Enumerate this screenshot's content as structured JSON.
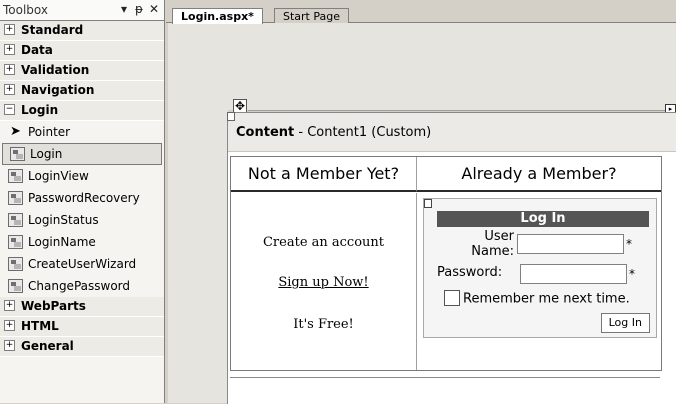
{
  "toolbox": {
    "title": "Toolbox",
    "header_buttons": {
      "dropdown": "▾",
      "pin": "ᵽ",
      "close": "✕"
    },
    "categories_top": [
      {
        "label": "Standard",
        "expander": "+"
      },
      {
        "label": "Data",
        "expander": "+"
      },
      {
        "label": "Validation",
        "expander": "+"
      },
      {
        "label": "Navigation",
        "expander": "+"
      }
    ],
    "login_category": {
      "label": "Login",
      "expander": "−"
    },
    "tools": [
      {
        "label": "Pointer",
        "icon": "pointer-icon"
      },
      {
        "label": "Login",
        "icon": "login-icon",
        "selected": true
      },
      {
        "label": "LoginView",
        "icon": "loginview-icon"
      },
      {
        "label": "PasswordRecovery",
        "icon": "passwordrecovery-icon"
      },
      {
        "label": "LoginStatus",
        "icon": "loginstatus-icon"
      },
      {
        "label": "LoginName",
        "icon": "loginname-icon"
      },
      {
        "label": "CreateUserWizard",
        "icon": "createuserwizard-icon"
      },
      {
        "label": "ChangePassword",
        "icon": "changepassword-icon"
      }
    ],
    "categories_bottom": [
      {
        "label": "WebParts",
        "expander": "+"
      },
      {
        "label": "HTML",
        "expander": "+"
      },
      {
        "label": "General",
        "expander": "+"
      }
    ]
  },
  "tabs": [
    {
      "label": "Login.aspx*",
      "active": true
    },
    {
      "label": "Start Page",
      "active": false
    }
  ],
  "designer": {
    "content_bold": "Content",
    "content_rest": " - Content1 (Custom)",
    "move_handle": "✥",
    "smart_tag": "▸",
    "not_member": "Not a Member Yet?",
    "already_member": "Already a Member?",
    "create_account": "Create an account",
    "sign_up": "Sign up Now!",
    "its_free": "It's Free!"
  },
  "login_control": {
    "title": "Log In",
    "user_label_1": "User",
    "user_label_2": "Name:",
    "password_label": "Password:",
    "required_marker": "*",
    "remember": "Remember me next time.",
    "button": "Log In",
    "username_value": "",
    "password_value": ""
  }
}
